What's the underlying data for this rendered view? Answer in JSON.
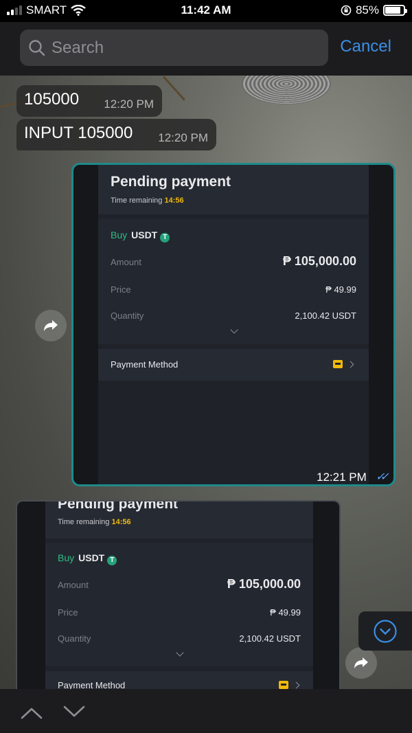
{
  "status_bar": {
    "carrier": "SMART",
    "time": "11:42 AM",
    "battery_percent": "85%",
    "battery_level": 0.85
  },
  "search": {
    "placeholder": "Search",
    "cancel_label": "Cancel"
  },
  "messages": [
    {
      "text": "105000",
      "time": "12:20 PM"
    },
    {
      "text": "INPUT 105000",
      "time": "12:20 PM"
    }
  ],
  "screenshot_1": {
    "title": "Pending payment",
    "remaining_label": "Time remaining",
    "remaining_value": "14:56",
    "buy_label": "Buy",
    "asset": "USDT",
    "asset_badge": "T",
    "amount_label": "Amount",
    "amount_value": "₱ 105,000.00",
    "price_label": "Price",
    "price_value": "₱ 49.99",
    "quantity_label": "Quantity",
    "quantity_value": "2,100.42 USDT",
    "payment_method_label": "Payment Method",
    "sent_time": "12:21 PM",
    "checks": "✓✓"
  },
  "screenshot_2": {
    "title": "Pending payment",
    "remaining_label": "Time remaining",
    "remaining_value": "14:56",
    "buy_label": "Buy",
    "asset": "USDT",
    "asset_badge": "T",
    "amount_label": "Amount",
    "amount_value": "₱ 105,000.00",
    "price_label": "Price",
    "price_value": "₱ 49.99",
    "quantity_label": "Quantity",
    "quantity_value": "2,100.42 USDT",
    "payment_method_label": "Payment Method"
  },
  "colors": {
    "accent_blue": "#3a8ee6",
    "tether_green": "#26a17b",
    "buy_green": "#2ebd85",
    "timer_yellow": "#f0b90b",
    "border_teal": "#1f8a8a"
  }
}
